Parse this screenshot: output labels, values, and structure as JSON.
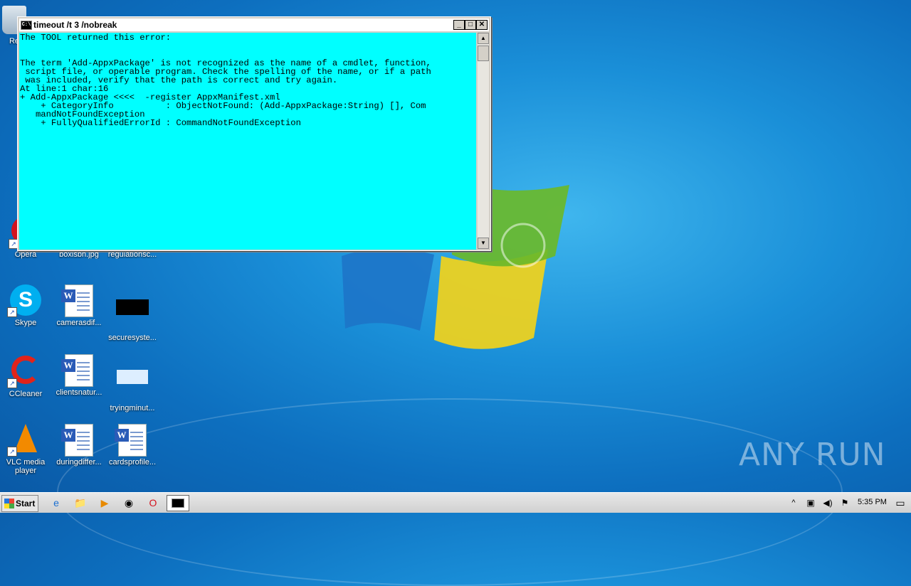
{
  "window": {
    "title": "timeout /t 3 /nobreak",
    "console_lines": [
      "The TOOL returned this error:",
      "",
      "",
      "The term 'Add-AppxPackage' is not recognized as the name of a cmdlet, function,",
      " script file, or operable program. Check the spelling of the name, or if a path",
      " was included, verify that the path is correct and try again.",
      "At line:1 char:16",
      "+ Add-AppxPackage <<<<  -register AppxManifest.xml",
      "    + CategoryInfo          : ObjectNotFound: (Add-AppxPackage:String) [], Com",
      "   mandNotFoundException",
      "    + FullyQualifiedErrorId : CommandNotFoundException"
    ]
  },
  "desktop": {
    "icons": [
      {
        "label": "Re"
      },
      {
        "label": "Opera"
      },
      {
        "label": "boxisbn.jpg"
      },
      {
        "label": "regulationsc..."
      },
      {
        "label": "Skype"
      },
      {
        "label": "camerasdif..."
      },
      {
        "label": "securesyste..."
      },
      {
        "label": "CCleaner"
      },
      {
        "label": "clientsnatur..."
      },
      {
        "label": "tryingminut..."
      },
      {
        "label": "VLC media player"
      },
      {
        "label": "duringdiffer..."
      },
      {
        "label": "cardsprofile..."
      }
    ]
  },
  "taskbar": {
    "start_label": "Start",
    "clock": "5:35 PM"
  },
  "watermark": "ANY RUN"
}
